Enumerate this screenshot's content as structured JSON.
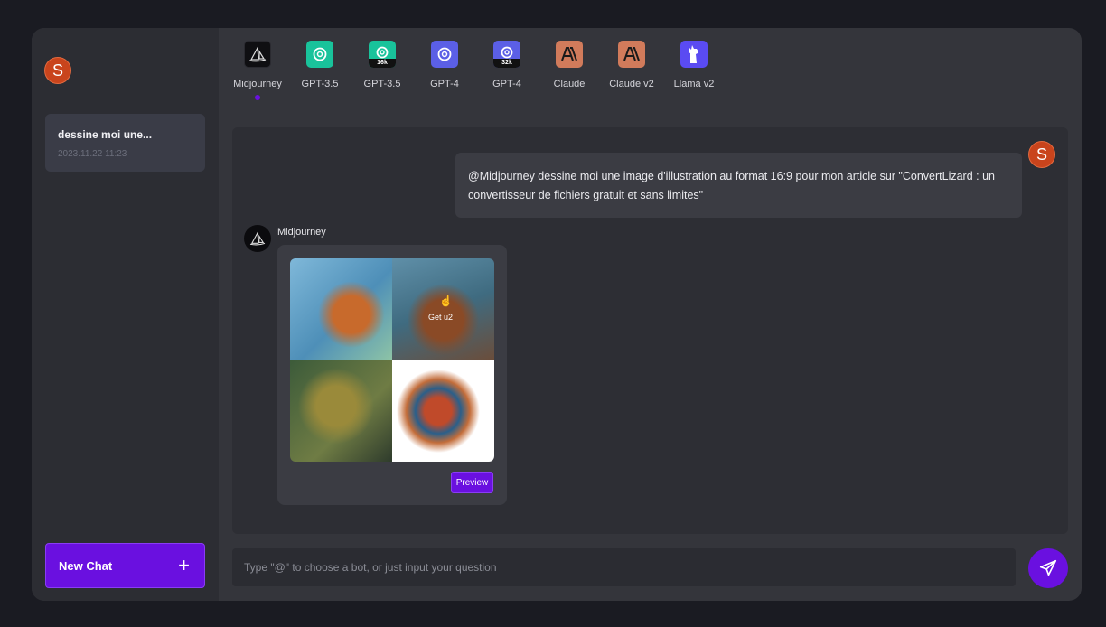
{
  "sidebar": {
    "avatar_letter": "S",
    "chats": [
      {
        "title": "dessine moi une...",
        "date": "2023.11.22 11:23"
      }
    ],
    "new_chat_label": "New Chat",
    "new_chat_icon": "plus-icon"
  },
  "bots": [
    {
      "label": "Midjourney",
      "icon": "midjourney-sail-icon",
      "tag": "",
      "color": "#0f0f12",
      "active": true
    },
    {
      "label": "GPT-3.5",
      "icon": "openai-icon",
      "tag": "",
      "color": "#19c39b"
    },
    {
      "label": "GPT-3.5",
      "icon": "openai-icon",
      "tag": "16k",
      "color": "#19c39b"
    },
    {
      "label": "GPT-4",
      "icon": "openai-icon",
      "tag": "",
      "color": "#5b5fe6"
    },
    {
      "label": "GPT-4",
      "icon": "openai-icon",
      "tag": "32k",
      "color": "#5b5fe6"
    },
    {
      "label": "Claude",
      "icon": "anthropic-icon",
      "tag": "",
      "color": "#d17b5b"
    },
    {
      "label": "Claude v2",
      "icon": "anthropic-icon",
      "tag": "",
      "color": "#d17b5b"
    },
    {
      "label": "Llama v2",
      "icon": "llama-icon",
      "tag": "",
      "color": "#5a4bf2"
    }
  ],
  "conversation": {
    "user_avatar_letter": "S",
    "user_message": "@Midjourney  dessine moi une image d'illustration au format 16:9 pour mon article sur \"ConvertLizard : un convertisseur de fichiers gratuit et sans limites\"",
    "bot_name": "Midjourney",
    "image_hover_label": "Get u2",
    "preview_label": "Preview"
  },
  "input": {
    "placeholder": "Type \"@\" to choose a bot, or just input your question",
    "send_icon": "send-icon"
  },
  "colors": {
    "accent": "#6a10e0",
    "avatar": "#c9441c"
  }
}
